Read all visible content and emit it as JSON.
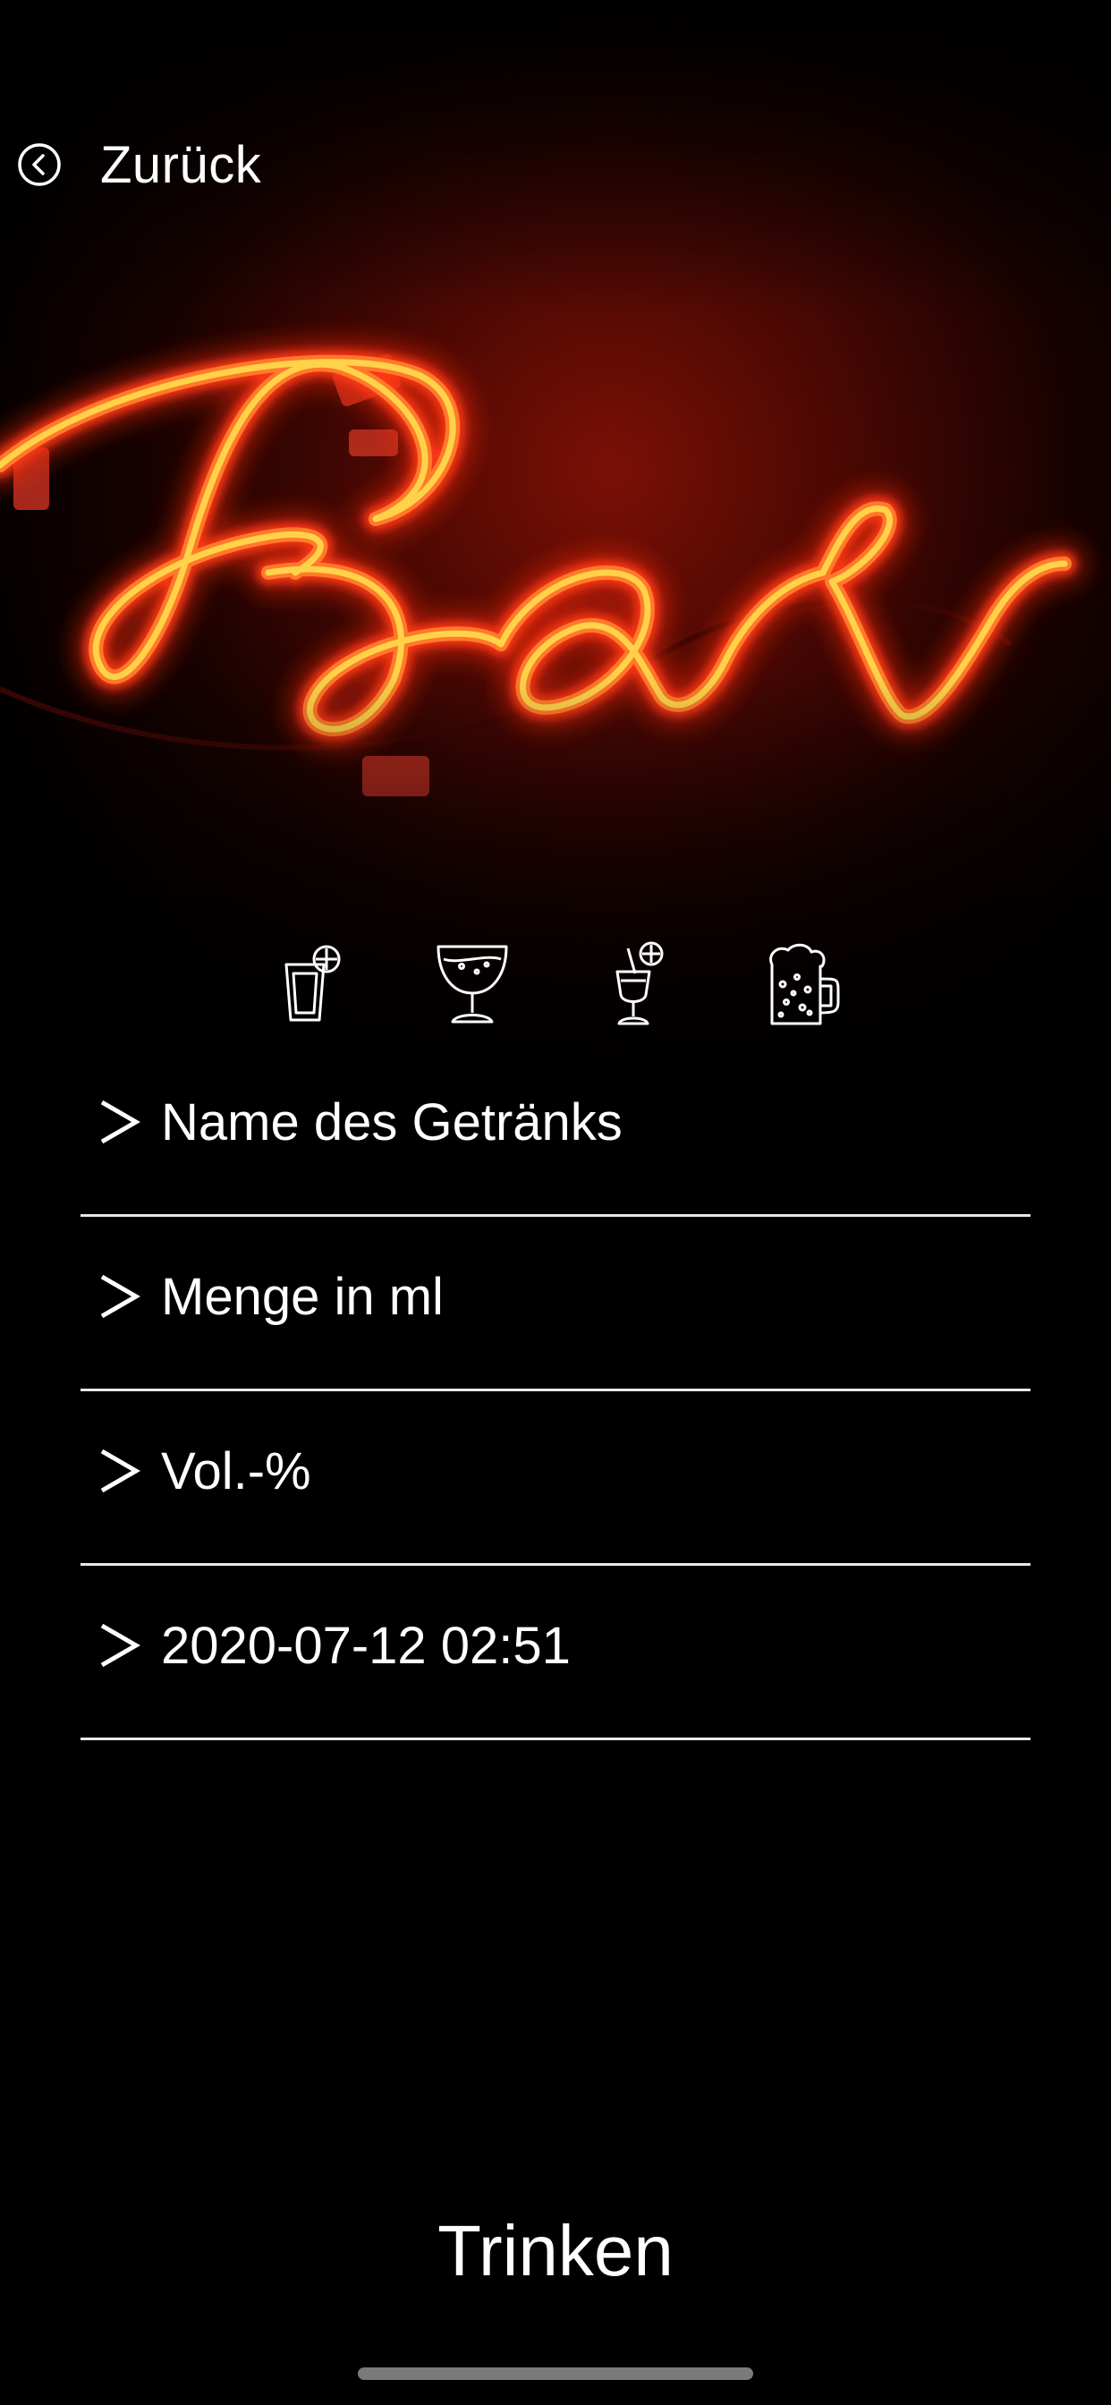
{
  "nav": {
    "back_label": "Zurück",
    "back_icon": "chevron-left-circle-icon"
  },
  "hero": {
    "neon_text": "Bar",
    "glow_color": "#ff2a10",
    "tube_color": "#ffd24a"
  },
  "drink_types": [
    {
      "icon": "shot-glass-icon"
    },
    {
      "icon": "wine-glass-icon"
    },
    {
      "icon": "cocktail-icon"
    },
    {
      "icon": "beer-mug-icon"
    }
  ],
  "form": {
    "name": {
      "placeholder": "Name des Getränks",
      "value": ""
    },
    "amount": {
      "placeholder": "Menge in ml",
      "value": ""
    },
    "abv": {
      "placeholder": "Vol.-%",
      "value": ""
    },
    "datetime": {
      "value": "2020-07-12 02:51"
    }
  },
  "submit_label": "Trinken",
  "colors": {
    "background": "#000000",
    "text": "#ffffff",
    "underline": "#e8e8e8"
  }
}
